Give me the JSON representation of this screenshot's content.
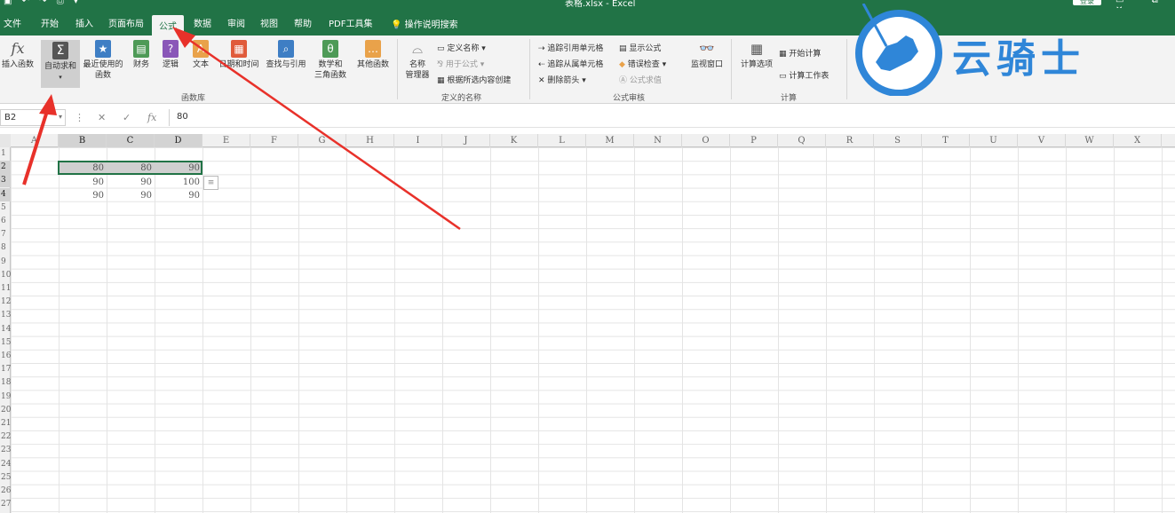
{
  "title_bar": {
    "quick_access": "▣ ↶ ↷ ⎙ ▾",
    "window_title": "表格.xlsx - Excel",
    "login_label": "登录",
    "window_controls": "▭ ⧉ ✕"
  },
  "tabs": [
    "文件",
    "开始",
    "插入",
    "页面布局",
    "公式",
    "数据",
    "审阅",
    "视图",
    "帮助",
    "PDF工具集"
  ],
  "active_tab": "公式",
  "tell_me": "操作说明搜索",
  "ribbon": {
    "function_library": {
      "group_label": "函数库",
      "insert_function": "插入函数",
      "autosum": "自动求和",
      "recently_used_1": "最近使用的",
      "recently_used_2": "函数",
      "financial": "财务",
      "logical": "逻辑",
      "text": "文本",
      "date_time": "日期和时间",
      "lookup": "查找与引用",
      "math_trig_1": "数学和",
      "math_trig_2": "三角函数",
      "more_functions": "其他函数"
    },
    "defined_names": {
      "group_label": "定义的名称",
      "name_manager_1": "名称",
      "name_manager_2": "管理器",
      "define_name": "定义名称",
      "use_in_formula": "用于公式",
      "create_from_selection": "根据所选内容创建"
    },
    "formula_auditing": {
      "group_label": "公式审核",
      "trace_precedents": "追踪引用单元格",
      "trace_dependents": "追踪从属单元格",
      "remove_arrows": "删除箭头",
      "show_formulas": "显示公式",
      "error_checking": "错误检查",
      "evaluate_formula": "公式求值",
      "watch_window": "监视窗口"
    },
    "calculation": {
      "group_label": "计算",
      "calc_options": "计算选项",
      "calc_now": "开始计算",
      "calc_sheet": "计算工作表"
    }
  },
  "formula_bar": {
    "name_box": "B2",
    "formula": "80"
  },
  "columns": [
    "A",
    "B",
    "C",
    "D",
    "E",
    "F",
    "G",
    "H",
    "I",
    "J",
    "K",
    "L",
    "M",
    "N",
    "O",
    "P",
    "Q",
    "R",
    "S",
    "T",
    "U",
    "V",
    "W",
    "X"
  ],
  "rows": [
    "1",
    "2",
    "3",
    "4",
    "5",
    "6",
    "7",
    "8",
    "9",
    "10",
    "11",
    "12",
    "13",
    "14",
    "15",
    "16",
    "17",
    "18",
    "19",
    "20",
    "21",
    "22",
    "23",
    "24",
    "25",
    "26",
    "27"
  ],
  "cells": {
    "B2": "80",
    "C2": "80",
    "D2": "90",
    "B3": "90",
    "C3": "90",
    "D3": "100",
    "B4": "90",
    "C4": "90",
    "D4": "90"
  },
  "watermark": {
    "text": "云骑士",
    "color": "#2f86d8"
  },
  "colors": {
    "excel_green": "#217346",
    "ribbon_bg": "#f3f3f3",
    "arrow_red": "#e8312a"
  }
}
